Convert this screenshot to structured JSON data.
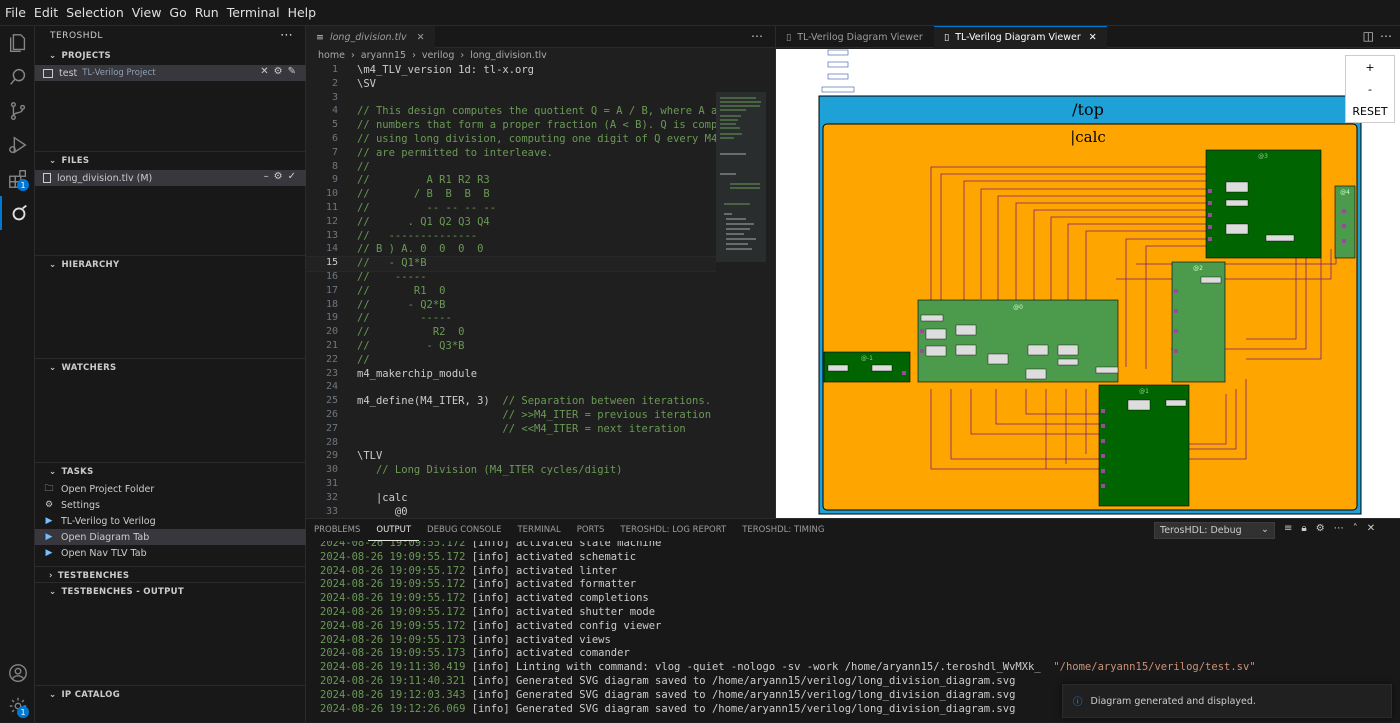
{
  "menu": [
    "File",
    "Edit",
    "Selection",
    "View",
    "Go",
    "Run",
    "Terminal",
    "Help"
  ],
  "sidebar": {
    "title": "TEROSHDL",
    "projects_header": "PROJECTS",
    "project": {
      "name": "test",
      "desc": "TL-Verilog Project"
    },
    "files_header": "FILES",
    "file": "long_division.tlv (M)",
    "hierarchy_header": "HIERARCHY",
    "watchers_header": "WATCHERS",
    "tasks_header": "TASKS",
    "tasks": [
      "Open Project Folder",
      "Settings",
      "TL-Verilog to Verilog",
      "Open Diagram Tab",
      "Open Nav TLV Tab"
    ],
    "testbenches_header": "TESTBENCHES",
    "testbenches_output_header": "TESTBENCHES - OUTPUT",
    "ip_catalog_header": "IP CATALOG",
    "badge_count": "1"
  },
  "editor": {
    "tab": "long_division.tlv",
    "breadcrumb": [
      "home",
      "aryann15",
      "verilog",
      "long_division.tlv"
    ],
    "current_line": 15,
    "lines": [
      {
        "n": "1",
        "t": "\\m4_TLV_version 1d: tl-x.org",
        "c": "kw"
      },
      {
        "n": "2",
        "t": "\\SV",
        "c": "kw"
      },
      {
        "n": "3",
        "t": "",
        "c": "kw"
      },
      {
        "n": "4",
        "t": "// This design computes the quotient Q = A / B, where A and",
        "c": "cmt"
      },
      {
        "n": "5",
        "t": "// numbers that form a proper fraction (A < B). Q is comput",
        "c": "cmt"
      },
      {
        "n": "6",
        "t": "// using long division, computing one digit of Q every M4_",
        "c": "cmt"
      },
      {
        "n": "7",
        "t": "// are permitted to interleave.",
        "c": "cmt"
      },
      {
        "n": "8",
        "t": "//",
        "c": "cmt"
      },
      {
        "n": "9",
        "t": "//         A R1 R2 R3",
        "c": "cmt"
      },
      {
        "n": "10",
        "t": "//       / B  B  B  B",
        "c": "cmt"
      },
      {
        "n": "11",
        "t": "//         -- -- -- --",
        "c": "cmt"
      },
      {
        "n": "12",
        "t": "//      . Q1 Q2 Q3 Q4",
        "c": "cmt"
      },
      {
        "n": "13",
        "t": "//   --------------",
        "c": "cmt"
      },
      {
        "n": "14",
        "t": "// B ) A. 0  0  0  0",
        "c": "cmt"
      },
      {
        "n": "15",
        "t": "//   - Q1*B",
        "c": "cmt"
      },
      {
        "n": "16",
        "t": "//    -----",
        "c": "cmt"
      },
      {
        "n": "17",
        "t": "//       R1  0",
        "c": "cmt"
      },
      {
        "n": "18",
        "t": "//      - Q2*B",
        "c": "cmt"
      },
      {
        "n": "19",
        "t": "//        -----",
        "c": "cmt"
      },
      {
        "n": "20",
        "t": "//          R2  0",
        "c": "cmt"
      },
      {
        "n": "21",
        "t": "//         - Q3*B",
        "c": "cmt"
      },
      {
        "n": "22",
        "t": "//",
        "c": "cmt"
      },
      {
        "n": "23",
        "t": "m4_makerchip_module",
        "c": "kw"
      },
      {
        "n": "24",
        "t": "",
        "c": "kw"
      },
      {
        "n": "25",
        "t": "m4_define(M4_ITER, 3)  ",
        "c": "kw",
        "tail": "// Separation between iterations."
      },
      {
        "n": "26",
        "t": "                       ",
        "c": "kw",
        "tail": "// >>M4_ITER = previous iteration"
      },
      {
        "n": "27",
        "t": "                       ",
        "c": "kw",
        "tail": "// <<M4_ITER = next iteration"
      },
      {
        "n": "28",
        "t": "",
        "c": "kw"
      },
      {
        "n": "29",
        "t": "\\TLV",
        "c": "kw"
      },
      {
        "n": "30",
        "t": "   // Long Division (M4_ITER cycles/digit)",
        "c": "cmt"
      },
      {
        "n": "31",
        "t": "",
        "c": "kw"
      },
      {
        "n": "32",
        "t": "   |calc",
        "c": "kw"
      },
      {
        "n": "33",
        "t": "      @0",
        "c": "kw"
      }
    ]
  },
  "viewer": {
    "tabs": [
      "TL-Verilog Diagram Viewer",
      "TL-Verilog Diagram Viewer"
    ],
    "top_label": "/top",
    "calc_label": "|calc",
    "stage_labels": [
      "@-1",
      "@0",
      "@1",
      "@2",
      "@3",
      "@4"
    ],
    "zoom_in": "+",
    "zoom_out": "-",
    "reset": "RESET"
  },
  "panel": {
    "tabs": [
      "PROBLEMS",
      "OUTPUT",
      "DEBUG CONSOLE",
      "TERMINAL",
      "PORTS",
      "TEROSHDL: LOG REPORT",
      "TEROSHDL: TIMING"
    ],
    "active_tab": "OUTPUT",
    "channel": "TerosHDL: Debug",
    "log": [
      {
        "ts": "2024-08-26 19:09:55.172",
        "msg": "[info] activated state machine"
      },
      {
        "ts": "2024-08-26 19:09:55.172",
        "msg": "[info] activated schematic"
      },
      {
        "ts": "2024-08-26 19:09:55.172",
        "msg": "[info] activated linter"
      },
      {
        "ts": "2024-08-26 19:09:55.172",
        "msg": "[info] activated formatter"
      },
      {
        "ts": "2024-08-26 19:09:55.172",
        "msg": "[info] activated completions"
      },
      {
        "ts": "2024-08-26 19:09:55.172",
        "msg": "[info] activated shutter mode"
      },
      {
        "ts": "2024-08-26 19:09:55.172",
        "msg": "[info] activated config viewer"
      },
      {
        "ts": "2024-08-26 19:09:55.173",
        "msg": "[info] activated views"
      },
      {
        "ts": "2024-08-26 19:09:55.173",
        "msg": "[info] activated comander"
      },
      {
        "ts": "2024-08-26 19:11:30.419",
        "msg": "[info] Linting with command: vlog -quiet -nologo -sv -work /home/aryann15/.teroshdl_WvMXk_  ",
        "tail": "\"/home/aryann15/verilog/test.sv\""
      },
      {
        "ts": "2024-08-26 19:11:40.321",
        "msg": "[info] Generated SVG diagram saved to /home/aryann15/verilog/long_division_diagram.svg"
      },
      {
        "ts": "2024-08-26 19:12:03.343",
        "msg": "[info] Generated SVG diagram saved to /home/aryann15/verilog/long_division_diagram.svg"
      },
      {
        "ts": "2024-08-26 19:12:26.069",
        "msg": "[info] Generated SVG diagram saved to /home/aryann15/verilog/long_division_diagram.svg"
      }
    ],
    "toast": "Diagram generated and displayed."
  }
}
